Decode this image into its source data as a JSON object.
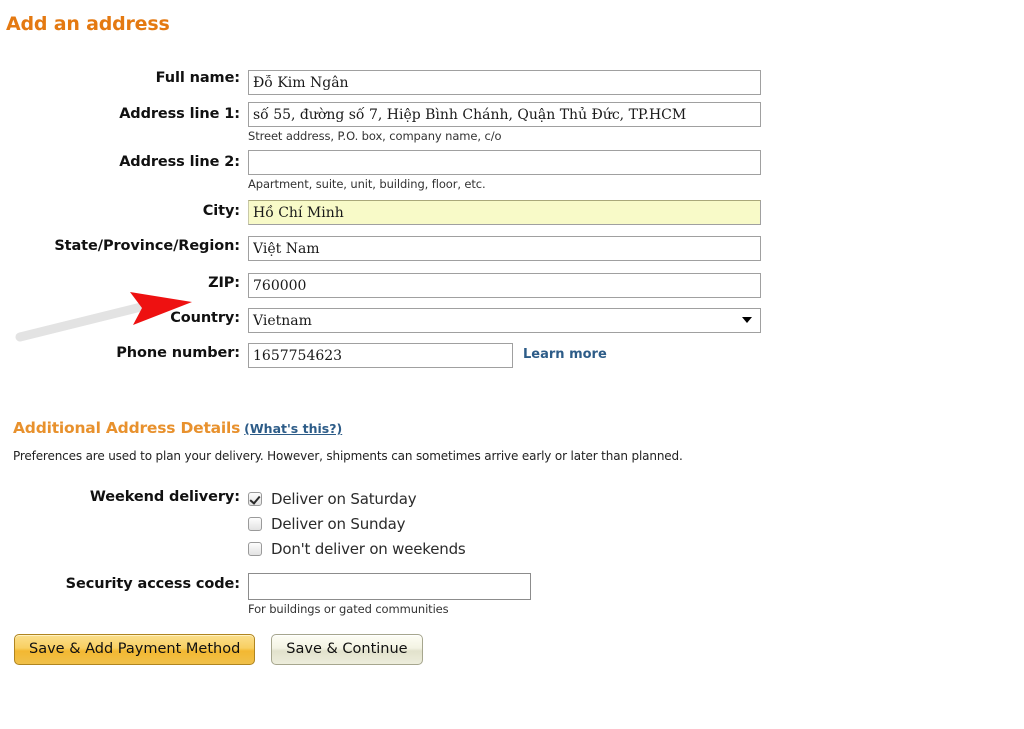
{
  "page": {
    "title": "Add an address"
  },
  "form": {
    "fields": [
      {
        "label": "Full name:",
        "value": "Đỗ Kim Ngân",
        "hint": ""
      },
      {
        "label": "Address line 1:",
        "value": "số 55, đường số 7, Hiệp Bình Chánh, Quận Thủ Đức, TP.HCM",
        "hint": "Street address, P.O. box, company name, c/o"
      },
      {
        "label": "Address line 2:",
        "value": "",
        "hint": "Apartment, suite, unit, building, floor, etc."
      },
      {
        "label": "City:",
        "value": "Hồ Chí Minh",
        "hint": ""
      },
      {
        "label": "State/Province/Region:",
        "value": "Việt Nam",
        "hint": ""
      },
      {
        "label": "ZIP:",
        "value": "760000",
        "hint": ""
      },
      {
        "label": "Country:",
        "value": "Vietnam",
        "hint": ""
      },
      {
        "label": "Phone number:",
        "value": "1657754623",
        "hint": ""
      }
    ],
    "learn_more_label": "Learn more"
  },
  "additional": {
    "heading": "Additional Address Details",
    "whats_this": "(What's this?)",
    "description": "Preferences are used to plan your delivery. However, shipments can sometimes arrive early or later than planned.",
    "weekend_label": "Weekend delivery:",
    "options": [
      {
        "label": "Deliver on Saturday",
        "checked": true
      },
      {
        "label": "Deliver on Sunday",
        "checked": false
      },
      {
        "label": "Don't deliver on weekends",
        "checked": false
      }
    ],
    "security_label": "Security access code:",
    "security_value": "",
    "security_hint": "For buildings or gated communities"
  },
  "buttons": {
    "primary": "Save & Add Payment Method",
    "secondary": "Save & Continue"
  },
  "colors": {
    "title_orange": "#E47911",
    "section_orange": "#E8912D",
    "link_blue": "#2D5C88",
    "autofill_yellow": "#F8FAC8",
    "annotation_red": "#EE1111",
    "annotation_gray": "#E2E2E2"
  }
}
